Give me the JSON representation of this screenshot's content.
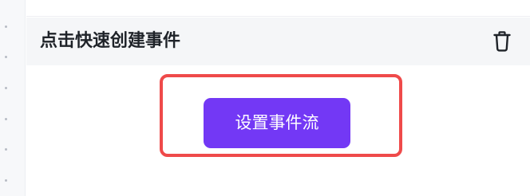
{
  "header": {
    "title": "点击快速创建事件",
    "delete_icon": "trash-icon"
  },
  "main": {
    "button_label": "设置事件流"
  },
  "colors": {
    "header_background": "#f5f6f8",
    "button_background": "#7338f5",
    "button_text": "#ffffff",
    "highlight_border": "#ef4a4a",
    "title_text": "#1f2329"
  }
}
